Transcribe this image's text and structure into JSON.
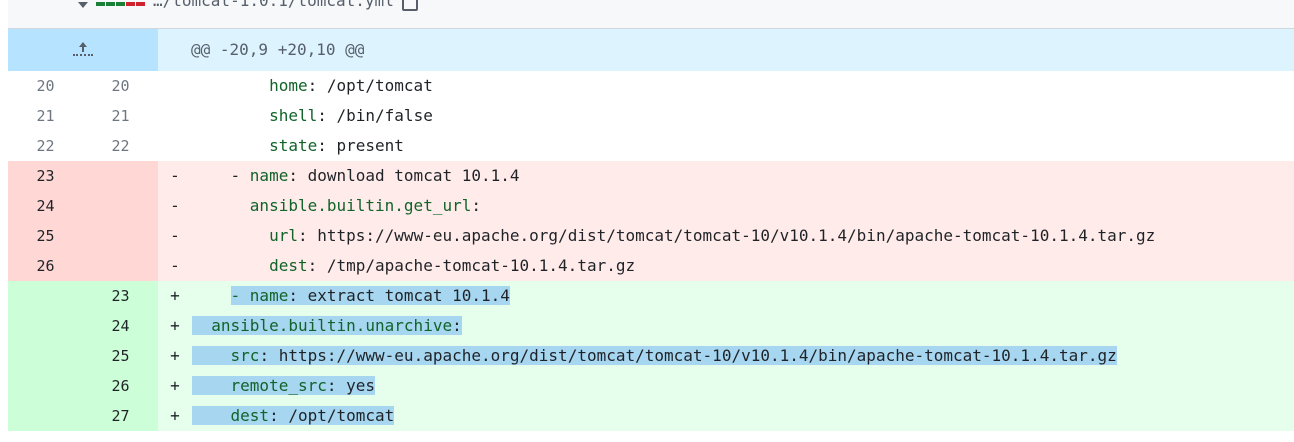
{
  "file_header": {
    "path": "…/tomcat-1.0.1/tomcat.yml"
  },
  "hunk": {
    "label": "@@ -20,9 +20,10 @@"
  },
  "lines": [
    {
      "type": "ctx",
      "old": "20",
      "new": "20",
      "marker": "",
      "indent": "        ",
      "key": "home",
      "sep": ": ",
      "value": "/opt/tomcat"
    },
    {
      "type": "ctx",
      "old": "21",
      "new": "21",
      "marker": "",
      "indent": "        ",
      "key": "shell",
      "sep": ": ",
      "value": "/bin/false"
    },
    {
      "type": "ctx",
      "old": "22",
      "new": "22",
      "marker": "",
      "indent": "        ",
      "key": "state",
      "sep": ": ",
      "value": "present"
    },
    {
      "type": "del",
      "old": "23",
      "new": "",
      "marker": "-",
      "indent": "    - ",
      "key": "name",
      "sep": ": ",
      "value": "download tomcat 10.1.4"
    },
    {
      "type": "del",
      "old": "24",
      "new": "",
      "marker": "-",
      "indent": "      ",
      "key": "ansible.builtin.get_url",
      "sep": ":",
      "value": ""
    },
    {
      "type": "del",
      "old": "25",
      "new": "",
      "marker": "-",
      "indent": "        ",
      "key": "url",
      "sep": ": ",
      "value": "https://www-eu.apache.org/dist/tomcat/tomcat-10/v10.1.4/bin/apache-tomcat-10.1.4.tar.gz"
    },
    {
      "type": "del",
      "old": "26",
      "new": "",
      "marker": "-",
      "indent": "        ",
      "key": "dest",
      "sep": ": ",
      "value": "/tmp/apache-tomcat-10.1.4.tar.gz"
    },
    {
      "type": "add",
      "old": "",
      "new": "23",
      "marker": "+",
      "indent": "    ",
      "key": "- name",
      "sep": ": ",
      "value": "extract tomcat 10.1.4"
    },
    {
      "type": "add",
      "old": "",
      "new": "24",
      "marker": "+",
      "indent": "",
      "key": "  ansible.builtin.unarchive",
      "sep": ":",
      "value": ""
    },
    {
      "type": "add",
      "old": "",
      "new": "25",
      "marker": "+",
      "indent": "",
      "key": "    src",
      "sep": ": ",
      "value": "https://www-eu.apache.org/dist/tomcat/tomcat-10/v10.1.4/bin/apache-tomcat-10.1.4.tar.gz"
    },
    {
      "type": "add",
      "old": "",
      "new": "26",
      "marker": "+",
      "indent": "",
      "key": "    remote_src",
      "sep": ": ",
      "value": "yes"
    },
    {
      "type": "add",
      "old": "",
      "new": "27",
      "marker": "+",
      "indent": "",
      "key": "    dest",
      "sep": ": ",
      "value": "/opt/tomcat"
    }
  ],
  "colors": {
    "hunk_bg": "#ddf4ff",
    "hunk_gutter": "#b6e3ff",
    "del_bg": "#ffebe9",
    "del_gutter": "#ffd7d5",
    "add_bg": "#e6ffec",
    "add_gutter": "#ccffd8",
    "selection": "#a6d6f0",
    "key": "#116329"
  },
  "icons": {
    "expand": "expand-up-icon",
    "copy": "copy-icon",
    "collapse": "chevron-down-icon"
  }
}
